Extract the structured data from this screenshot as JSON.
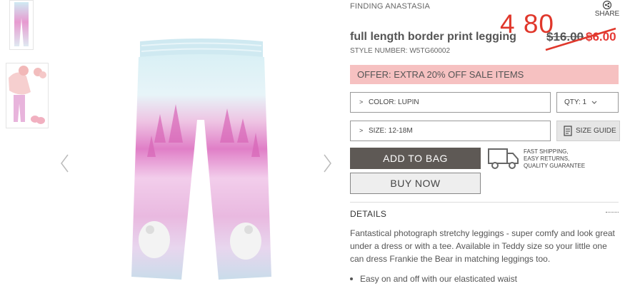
{
  "brand": "FINDING ANASTASIA",
  "share": {
    "label": "SHARE",
    "icon": "share-icon"
  },
  "product": {
    "title": "full length border print legging",
    "style_number": "STYLE NUMBER: W5TG60002"
  },
  "price": {
    "overlay_note": "4 80",
    "original": "$16.00",
    "sale": "$6.00"
  },
  "offer": "OFFER: EXTRA 20% OFF SALE ITEMS",
  "options": {
    "color": "COLOR: LUPIN",
    "size": "SIZE: 12-18M",
    "qty": "QTY: 1",
    "size_guide": "SIZE GUIDE"
  },
  "buttons": {
    "add_to_bag": "ADD TO BAG",
    "buy_now": "BUY NOW"
  },
  "shipping": {
    "line1": "FAST SHIPPING,",
    "line2": "EASY RETURNS,",
    "line3": "QUALITY GUARANTEE"
  },
  "details": {
    "heading": "DETAILS",
    "description": "Fantastical photograph stretchy leggings - super comfy and look great under a dress or with a tee. Available in Teddy size so your little one can dress Frankie the Bear in matching leggings too.",
    "bullet_1": "Easy on and off with our elasticated waist"
  },
  "colors": {
    "offer_bg": "#f6c1c1",
    "sale_red": "#e53935",
    "add_bg": "#5e5955",
    "overlay_red": "#e0372b"
  }
}
